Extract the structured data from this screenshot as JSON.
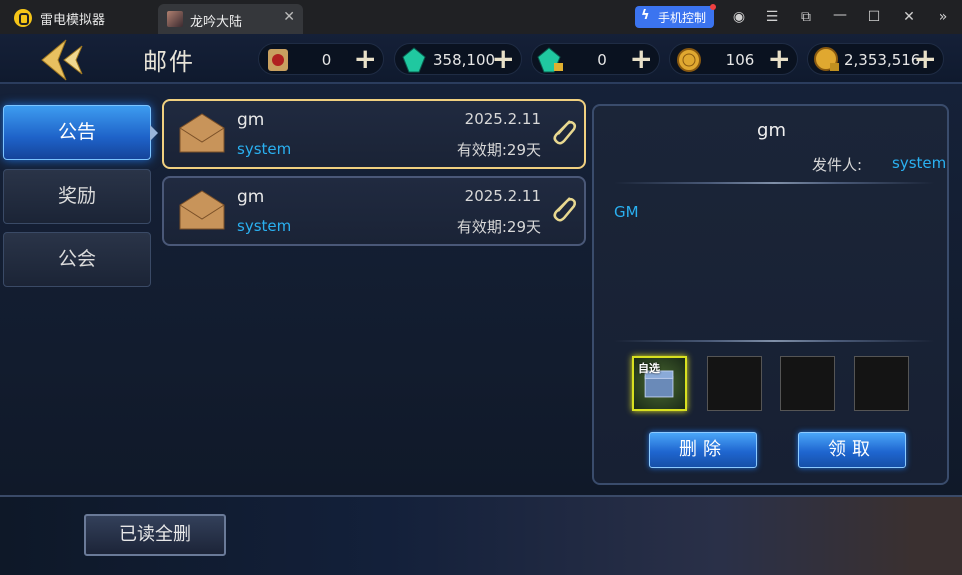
{
  "emulator": {
    "name": "雷电模拟器",
    "phone_control": "手机控制"
  },
  "tab": {
    "title": "龙吟大陆"
  },
  "page": {
    "title": "邮件"
  },
  "resources": [
    {
      "icon": "scroll-icon",
      "value": "0"
    },
    {
      "icon": "green-gem-icon",
      "value": "358,100"
    },
    {
      "icon": "locked-gem-icon",
      "value": "0"
    },
    {
      "icon": "gold-coin-icon",
      "value": "106"
    },
    {
      "icon": "locked-coin-icon",
      "value": "2,353,516"
    }
  ],
  "side_tabs": [
    {
      "label": "公告",
      "active": true
    },
    {
      "label": "奖励",
      "active": false
    },
    {
      "label": "公会",
      "active": false
    }
  ],
  "mails": [
    {
      "sender": "gm",
      "from": "system",
      "date": "2025.2.11",
      "expiry": "有效期:29天",
      "selected": true
    },
    {
      "sender": "gm",
      "from": "system",
      "date": "2025.2.11",
      "expiry": "有效期:29天",
      "selected": false
    }
  ],
  "detail": {
    "title": "gm",
    "sender_label": "发件人:",
    "sender": "system",
    "body": "GM",
    "attachment_tag": "自选",
    "delete_label": "删除",
    "claim_label": "领取"
  },
  "bottom": {
    "delete_all_read": "已读全删"
  }
}
